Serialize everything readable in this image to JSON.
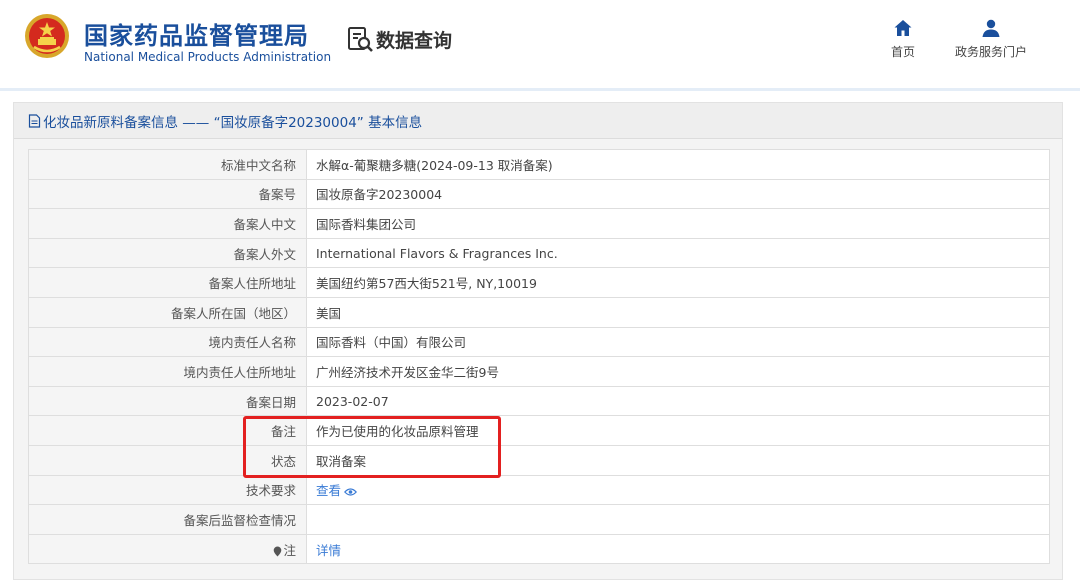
{
  "header": {
    "org_name_cn": "国家药品监督管理局",
    "org_name_en": "National Medical Products Administration",
    "page_name": "数据查询",
    "nav": [
      {
        "label": "首页",
        "icon": "home-icon"
      },
      {
        "label": "政务服务门户",
        "icon": "user-icon"
      }
    ]
  },
  "panel": {
    "title": "化妆品新原料备案信息 —— “国妆原备字20230004” 基本信息",
    "title_icon": "document-icon"
  },
  "rows": [
    {
      "label": "标准中文名称",
      "value": "水解α-葡聚糖多糖(2024-09-13 取消备案)"
    },
    {
      "label": "备案号",
      "value": "国妆原备字20230004"
    },
    {
      "label": "备案人中文",
      "value": "国际香料集团公司"
    },
    {
      "label": "备案人外文",
      "value": "International Flavors & Fragrances Inc."
    },
    {
      "label": "备案人住所地址",
      "value": "美国纽约第57西大街521号, NY,10019"
    },
    {
      "label": "备案人所在国（地区）",
      "value": "美国"
    },
    {
      "label": "境内责任人名称",
      "value": "国际香料（中国）有限公司"
    },
    {
      "label": "境内责任人住所地址",
      "value": "广州经济技术开发区金华二街9号"
    },
    {
      "label": "备案日期",
      "value": "2023-02-07"
    },
    {
      "label": "备注",
      "value": "作为已使用的化妆品原料管理"
    },
    {
      "label": "状态",
      "value": "取消备案"
    },
    {
      "label": "技术要求",
      "value": "查看",
      "link": true,
      "icon": "eye-icon"
    },
    {
      "label": "备案后监督检查情况",
      "value": ""
    },
    {
      "label": "注",
      "value": "详情",
      "link": true,
      "label_icon": "pin-icon"
    }
  ],
  "colors": {
    "brand_blue": "#1a4f9c",
    "link_blue": "#3a7bd5",
    "highlight_red": "#e32020"
  }
}
